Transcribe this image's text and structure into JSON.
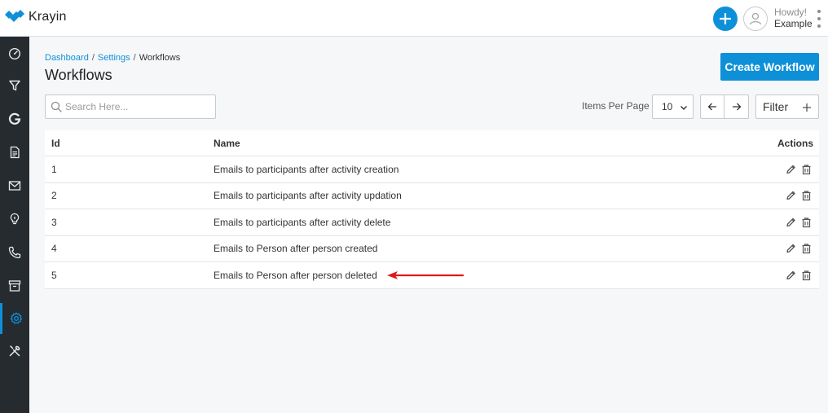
{
  "header": {
    "logo_text": "Krayin",
    "greeting": "Howdy!",
    "user_name": "Example"
  },
  "breadcrumb": [
    {
      "label": "Dashboard"
    },
    {
      "label": "Settings"
    },
    {
      "label": "Workflows"
    }
  ],
  "breadcrumb_separator": "/",
  "page_title": "Workflows",
  "create_button": "Create Workflow",
  "search": {
    "placeholder": "Search Here..."
  },
  "pagination": {
    "items_per_page_label": "Items Per Page",
    "items_per_page_value": "10"
  },
  "filter_label": "Filter",
  "table": {
    "headers": {
      "id": "Id",
      "name": "Name",
      "actions": "Actions"
    },
    "rows": [
      {
        "id": "1",
        "name": "Emails to participants after activity creation"
      },
      {
        "id": "2",
        "name": "Emails to participants after activity updation"
      },
      {
        "id": "3",
        "name": "Emails to participants after activity delete"
      },
      {
        "id": "4",
        "name": "Emails to Person after person created"
      },
      {
        "id": "5",
        "name": "Emails to Person after person deleted"
      }
    ]
  },
  "sidebar": {
    "items": [
      {
        "icon": "dashboard-icon"
      },
      {
        "icon": "filter-icon"
      },
      {
        "icon": "g-icon"
      },
      {
        "icon": "document-icon"
      },
      {
        "icon": "mail-icon"
      },
      {
        "icon": "lightbulb-icon"
      },
      {
        "icon": "phone-icon"
      },
      {
        "icon": "archive-icon"
      },
      {
        "icon": "settings-icon",
        "active": true
      },
      {
        "icon": "tools-icon"
      }
    ]
  },
  "colors": {
    "accent": "#0e90d9",
    "sidebar_bg": "#262b2f",
    "annotation_arrow": "#e0191b"
  }
}
